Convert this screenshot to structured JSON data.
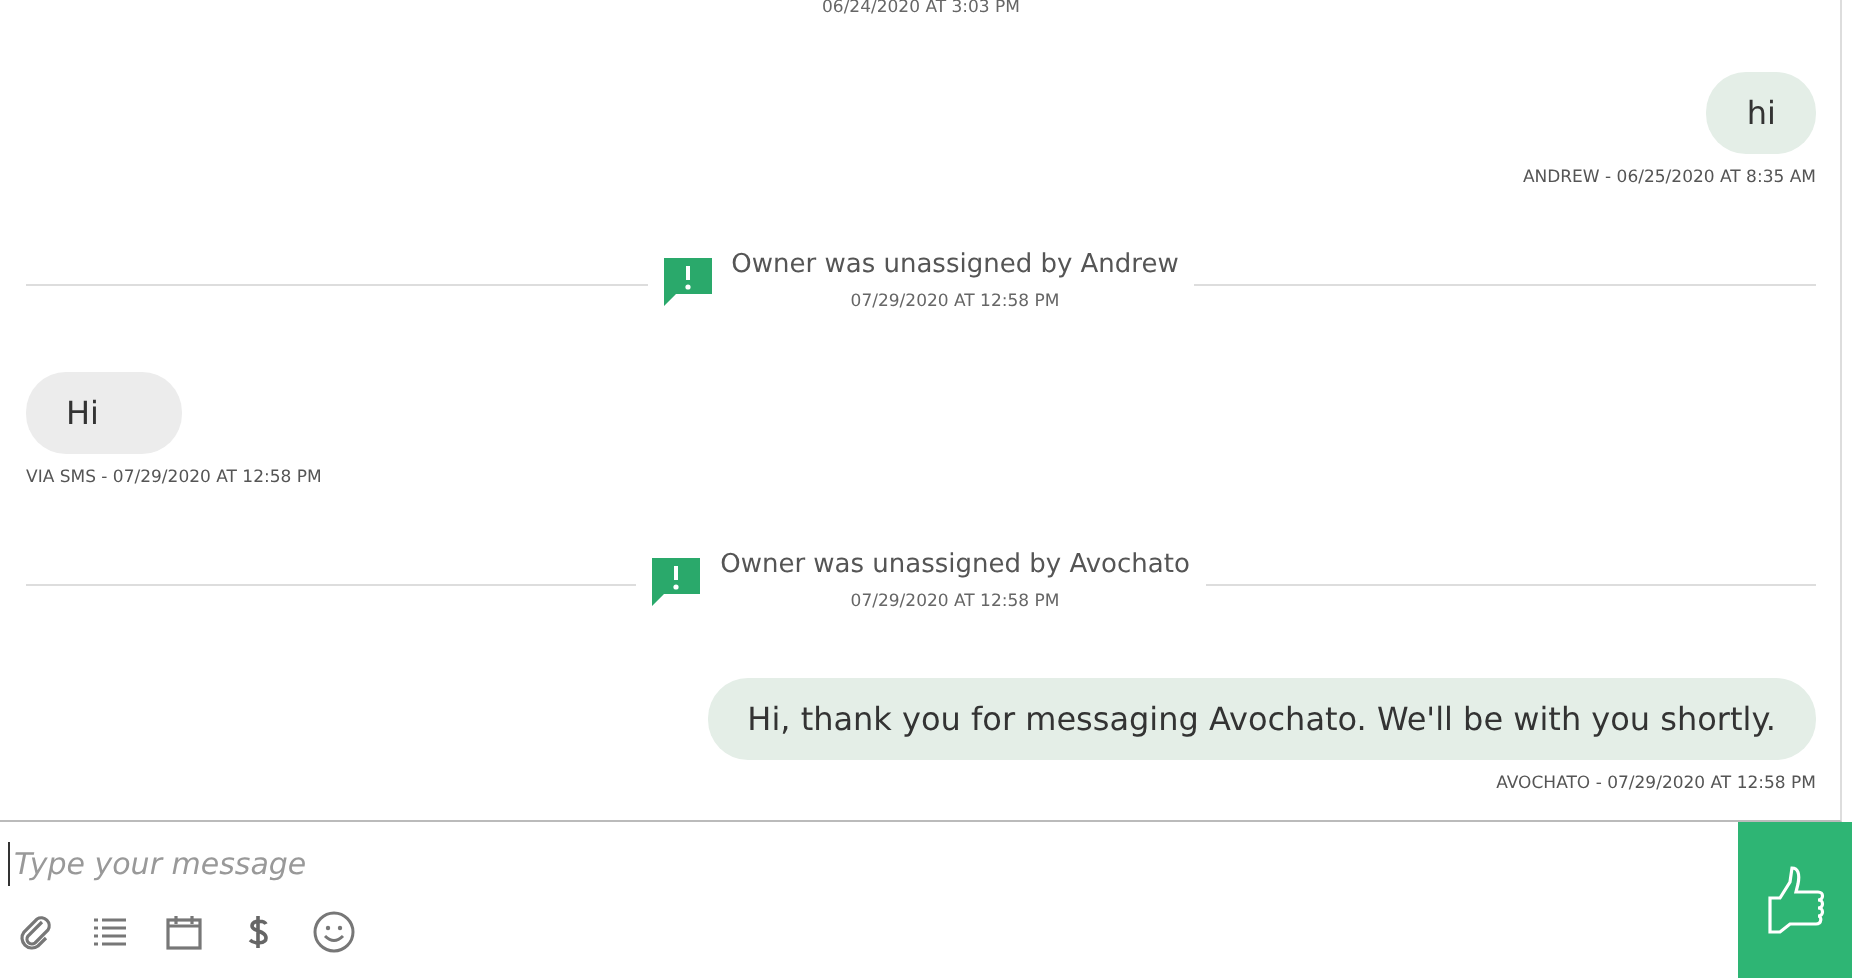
{
  "messages": [
    {
      "kind": "time",
      "time": "06/24/2020 AT 3:03 PM"
    },
    {
      "kind": "outgoing",
      "text": "hi",
      "meta": "ANDREW - 06/25/2020 AT 8:35 AM"
    },
    {
      "kind": "event",
      "text": "Owner was unassigned by Andrew",
      "time": "07/29/2020 AT 12:58 PM"
    },
    {
      "kind": "incoming",
      "text": "Hi",
      "meta": "VIA SMS - 07/29/2020 AT 12:58 PM"
    },
    {
      "kind": "event",
      "text": "Owner was unassigned by Avochato",
      "time": "07/29/2020 AT 12:58 PM"
    },
    {
      "kind": "outgoing",
      "text": "Hi, thank you for messaging Avochato. We'll be with you shortly.",
      "meta": "AVOCHATO - 07/29/2020 AT 12:58 PM"
    }
  ],
  "composer": {
    "placeholder": "Type your message"
  }
}
